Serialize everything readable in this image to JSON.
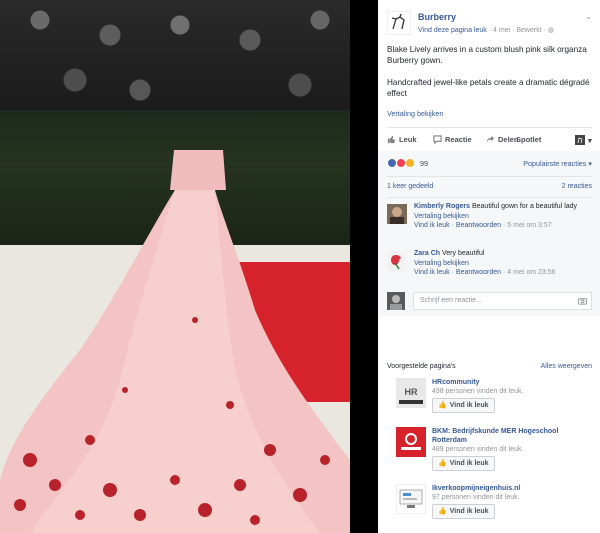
{
  "post": {
    "page_name": "Burberry",
    "meta_link": "Vind deze pagina leuk",
    "meta_sep": " · ",
    "meta_date": "4 mei",
    "meta_edit": "Bewerkt",
    "text_1": "Blake Lively arrives in a custom blush pink silk organza Burberry gown.",
    "text_2": "Handcrafted jewel-like petals create a dramatic dégradé effect",
    "see_translation": "Vertaling bekijken"
  },
  "actions": {
    "like": "Leuk",
    "comment": "Reactie",
    "share": "Delen",
    "photo": "Spotlet"
  },
  "reactions": {
    "count": "99",
    "popular": "Populairste reacties ▾",
    "shares": "1 keer gedeeld",
    "comments_count": "2 reacties"
  },
  "comments": [
    {
      "name": "Kimberly Rogers",
      "text": " Beautiful gown for a beautiful lady",
      "translate": "Vertaling bekijken",
      "like": "Vind ik leuk",
      "reply": "Beantwoorden",
      "time": "5 mei om 3:57"
    },
    {
      "name": "Zara Ch",
      "text": " Very beautiful",
      "translate": "Vertaling bekijken",
      "like": "Vind ik leuk",
      "reply": "Beantwoorden",
      "time": "4 mei om 23:56"
    }
  ],
  "write_comment": {
    "placeholder": "Schrijf een reactie..."
  },
  "suggested": {
    "title": "Voorgestelde pagina's",
    "see_all": "Alles weergeven",
    "items": [
      {
        "name": "HRcommunity",
        "count": "498 personen vinden dit leuk.",
        "button": "Vind ik leuk"
      },
      {
        "name": "BKM: Bedrijfskunde MER Hogeschool Rotterdam",
        "count": "489 personen vinden dit leuk.",
        "button": "Vind ik leuk"
      },
      {
        "name": "Ikverkoopmijneigenhuis.nl",
        "count": "97 personen vinden dit leuk.",
        "button": "Vind ik leuk"
      }
    ]
  },
  "colors": {
    "link_blue": "#365899",
    "carpet_red": "#d6222a",
    "gown_pink": "#f3c4c3"
  }
}
